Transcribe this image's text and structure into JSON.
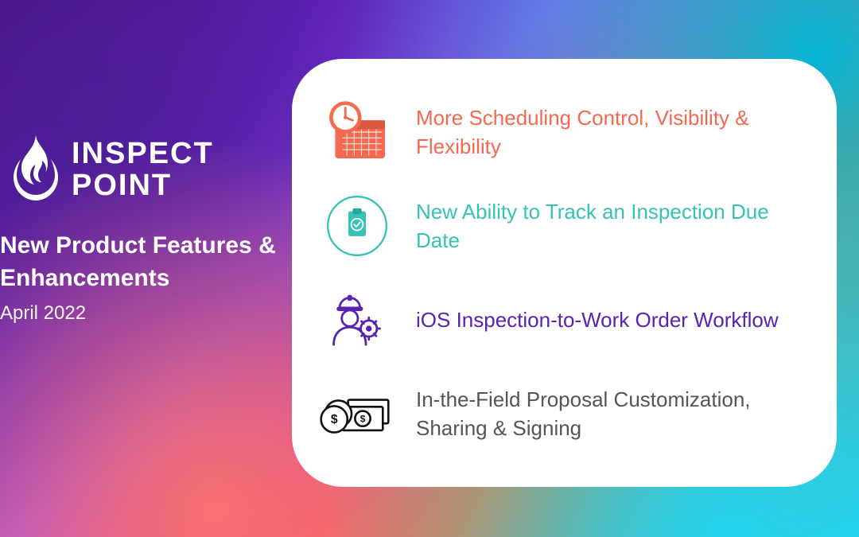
{
  "brand": {
    "line1": "INSPECT",
    "line2": "POINT"
  },
  "subtitle": "New Product Features & Enhancements",
  "date": "April 2022",
  "features": [
    {
      "text": "More Scheduling Control, Visibility & Flexibility",
      "icon": "calendar-clock-icon",
      "color": "#f4694f"
    },
    {
      "text": "New Ability to Track an Inspection Due Date",
      "icon": "clipboard-check-icon",
      "color": "#36c2b4"
    },
    {
      "text": "iOS Inspection-to-Work Order Workflow",
      "icon": "worker-gear-icon",
      "color": "#5b21b6"
    },
    {
      "text": "In-the-Field Proposal Customization, Sharing & Signing",
      "icon": "money-dollar-icon",
      "color": "#555459"
    }
  ]
}
